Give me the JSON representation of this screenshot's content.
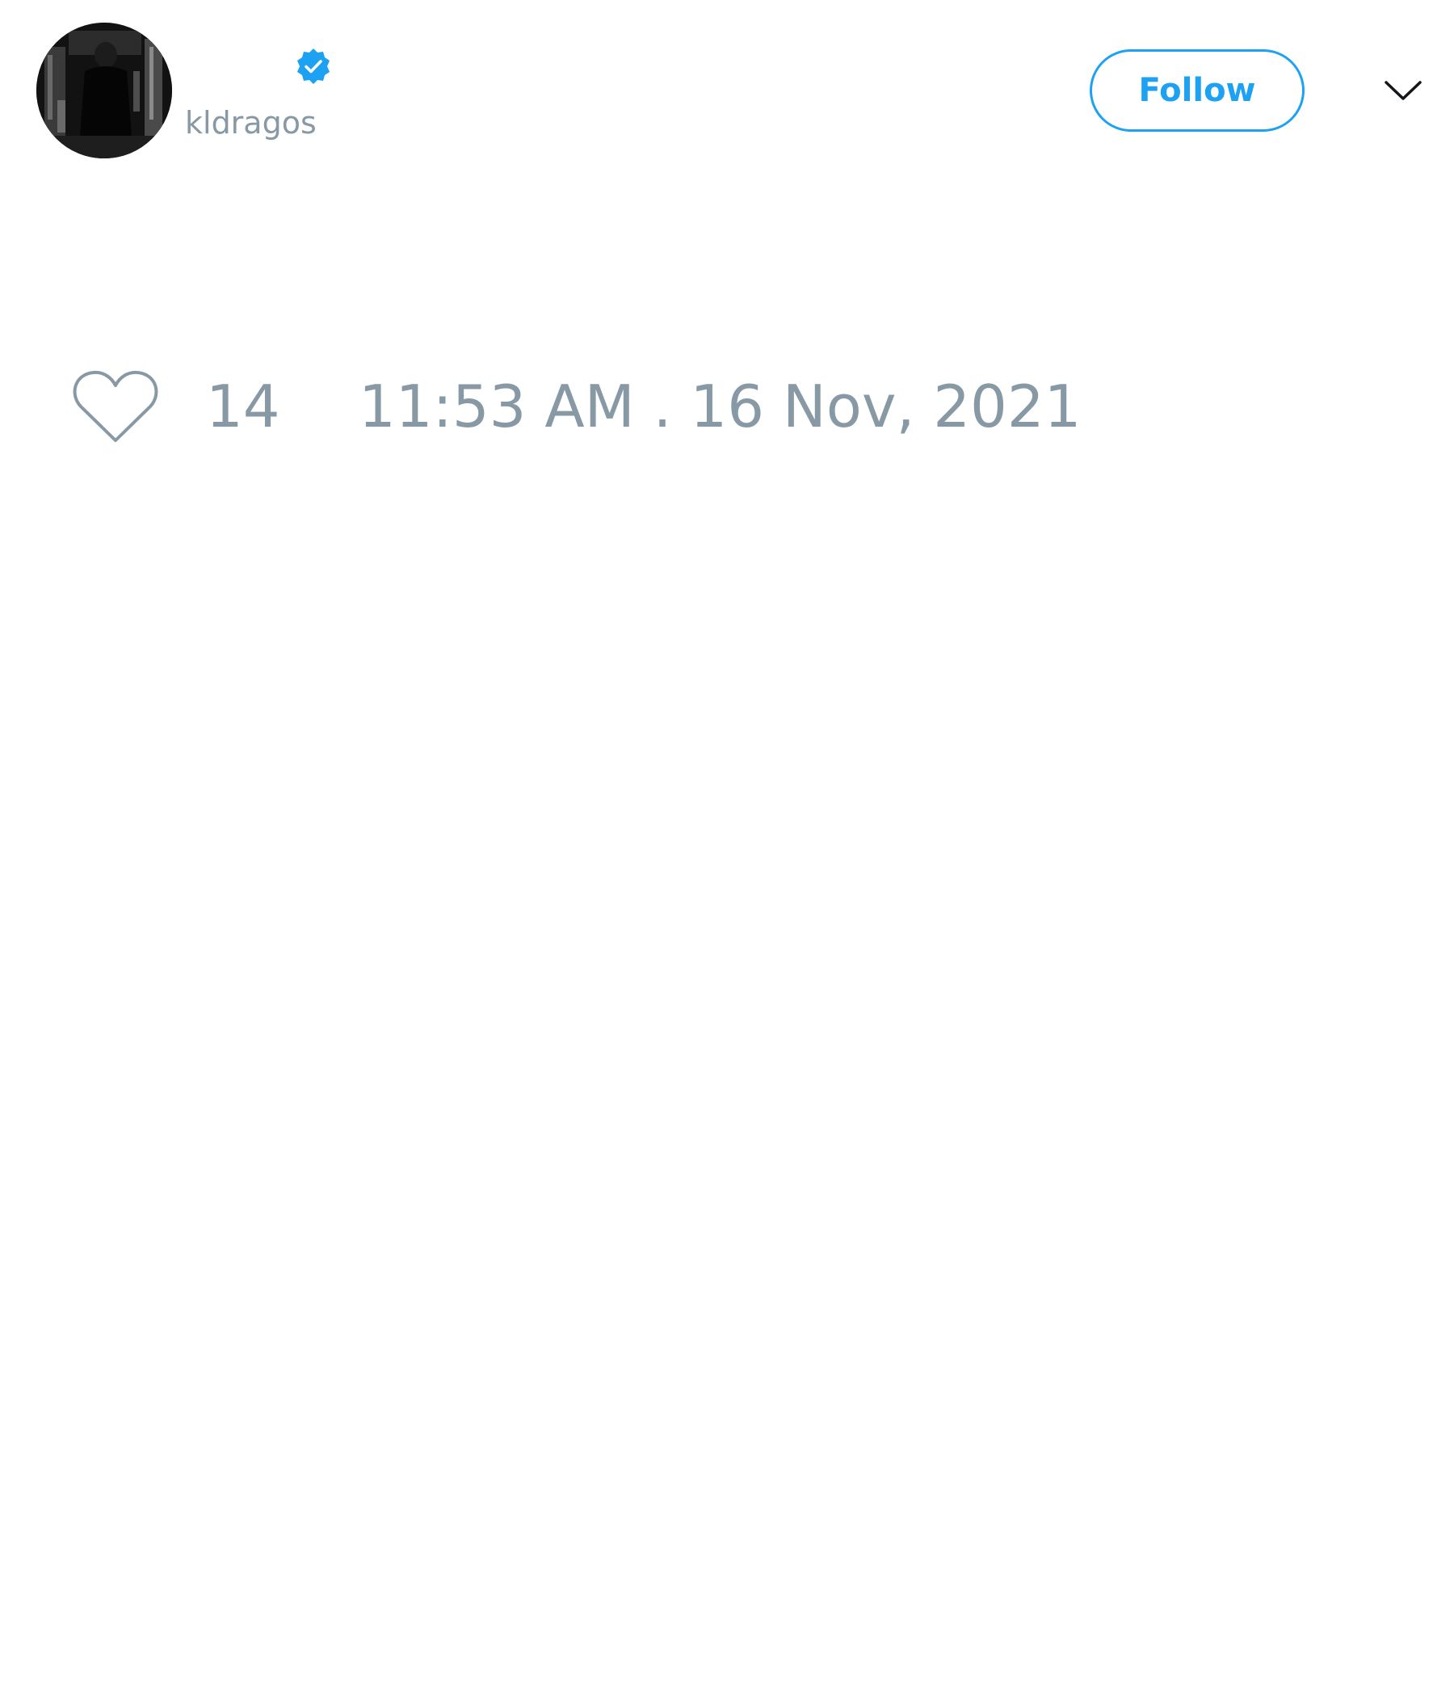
{
  "tweet": {
    "author": {
      "display_name": "",
      "handle": "kldragos",
      "verified": true,
      "avatar_icon": "avatar-photo"
    },
    "follow_label": "Follow",
    "menu_icon": "chevron-down-icon",
    "likes": {
      "icon": "heart-icon",
      "count": "14"
    },
    "timestamp": "11:53 AM . 16 Nov, 2021"
  },
  "colors": {
    "accent": "#1da1f2",
    "muted_text": "#8899a6",
    "verified_badge": "#1da1f2",
    "background": "#ffffff"
  }
}
